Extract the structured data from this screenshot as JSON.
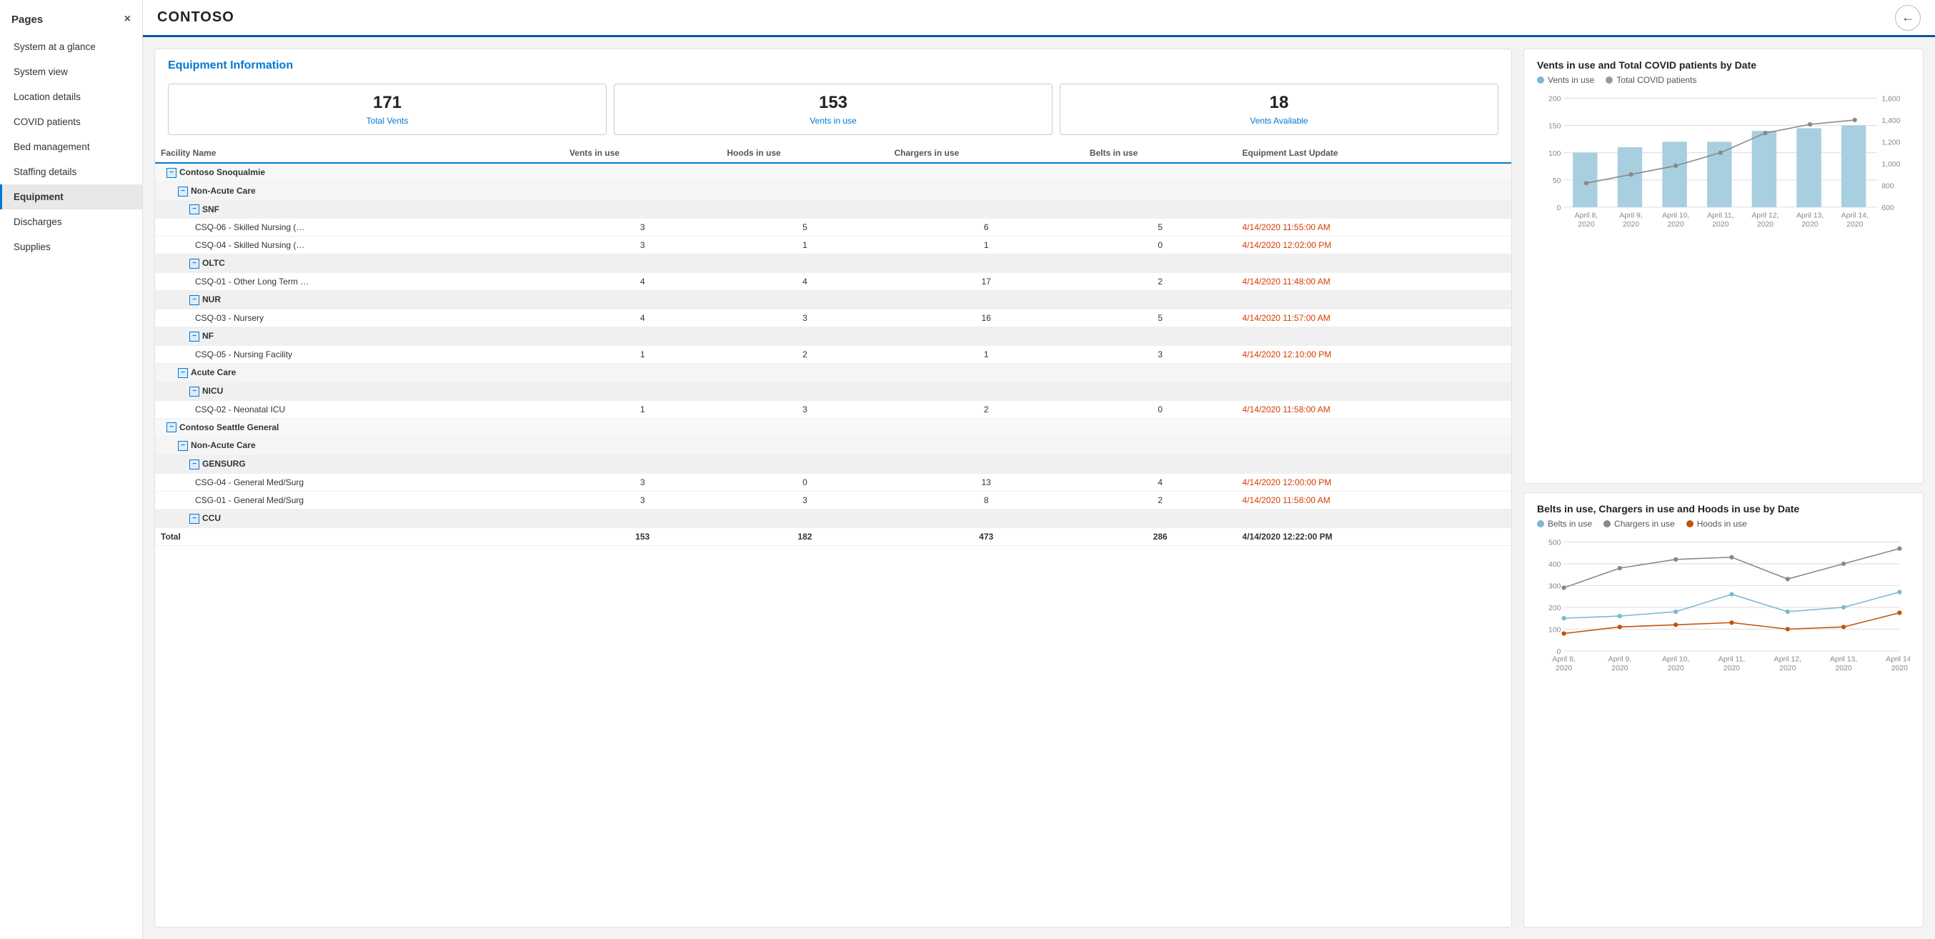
{
  "sidebar": {
    "header": "Pages",
    "close_label": "×",
    "items": [
      {
        "id": "system-at-glance",
        "label": "System at a glance",
        "active": false
      },
      {
        "id": "system-view",
        "label": "System view",
        "active": false
      },
      {
        "id": "location-details",
        "label": "Location details",
        "active": false
      },
      {
        "id": "covid-patients",
        "label": "COVID patients",
        "active": false
      },
      {
        "id": "bed-management",
        "label": "Bed management",
        "active": false
      },
      {
        "id": "staffing-details",
        "label": "Staffing details",
        "active": false
      },
      {
        "id": "equipment",
        "label": "Equipment",
        "active": true
      },
      {
        "id": "discharges",
        "label": "Discharges",
        "active": false
      },
      {
        "id": "supplies",
        "label": "Supplies",
        "active": false
      }
    ]
  },
  "topbar": {
    "title": "CONTOSO",
    "back_label": "←"
  },
  "equipment": {
    "section_title": "Equipment Information",
    "stats": [
      {
        "number": "171",
        "label": "Total Vents"
      },
      {
        "number": "153",
        "label": "Vents in use"
      },
      {
        "number": "18",
        "label": "Vents Available"
      }
    ],
    "table": {
      "columns": [
        "Facility Name",
        "Vents in use",
        "Hoods in use",
        "Chargers in use",
        "Belts in use",
        "Equipment Last Update"
      ],
      "rows": [
        {
          "type": "group1",
          "name": "Contoso Snoqualmie",
          "indent": 1,
          "expand": true
        },
        {
          "type": "group2",
          "name": "Non-Acute Care",
          "indent": 2,
          "expand": true
        },
        {
          "type": "group3",
          "name": "SNF",
          "indent": 3,
          "expand": true
        },
        {
          "type": "data",
          "name": "CSQ-06 - Skilled Nursing (…",
          "indent": 4,
          "vents": 3,
          "hoods": 5,
          "chargers": 6,
          "belts": 5,
          "date": "4/14/2020 11:55:00 AM"
        },
        {
          "type": "data",
          "name": "CSQ-04 - Skilled Nursing (…",
          "indent": 4,
          "vents": 3,
          "hoods": 1,
          "chargers": 1,
          "belts": 0,
          "date": "4/14/2020 12:02:00 PM"
        },
        {
          "type": "group3",
          "name": "OLTC",
          "indent": 3,
          "expand": true
        },
        {
          "type": "data",
          "name": "CSQ-01 - Other Long Term …",
          "indent": 4,
          "vents": 4,
          "hoods": 4,
          "chargers": 17,
          "belts": 2,
          "date": "4/14/2020 11:48:00 AM"
        },
        {
          "type": "group3",
          "name": "NUR",
          "indent": 3,
          "expand": true
        },
        {
          "type": "data",
          "name": "CSQ-03 - Nursery",
          "indent": 4,
          "vents": 4,
          "hoods": 3,
          "chargers": 16,
          "belts": 5,
          "date": "4/14/2020 11:57:00 AM"
        },
        {
          "type": "group3",
          "name": "NF",
          "indent": 3,
          "expand": true
        },
        {
          "type": "data",
          "name": "CSQ-05 - Nursing Facility",
          "indent": 4,
          "vents": 1,
          "hoods": 2,
          "chargers": 1,
          "belts": 3,
          "date": "4/14/2020 12:10:00 PM"
        },
        {
          "type": "group2",
          "name": "Acute Care",
          "indent": 2,
          "expand": true
        },
        {
          "type": "group3",
          "name": "NICU",
          "indent": 3,
          "expand": true
        },
        {
          "type": "data",
          "name": "CSQ-02 - Neonatal ICU",
          "indent": 4,
          "vents": 1,
          "hoods": 3,
          "chargers": 2,
          "belts": 0,
          "date": "4/14/2020 11:58:00 AM"
        },
        {
          "type": "group1",
          "name": "Contoso Seattle General",
          "indent": 1,
          "expand": true
        },
        {
          "type": "group2",
          "name": "Non-Acute Care",
          "indent": 2,
          "expand": true
        },
        {
          "type": "group3",
          "name": "GENSURG",
          "indent": 3,
          "expand": true
        },
        {
          "type": "data",
          "name": "CSG-04 - General Med/Surg",
          "indent": 4,
          "vents": 3,
          "hoods": 0,
          "chargers": 13,
          "belts": 4,
          "date": "4/14/2020 12:00:00 PM"
        },
        {
          "type": "data",
          "name": "CSG-01 - General Med/Surg",
          "indent": 4,
          "vents": 3,
          "hoods": 3,
          "chargers": 8,
          "belts": 2,
          "date": "4/14/2020 11:58:00 AM"
        },
        {
          "type": "group3",
          "name": "CCU",
          "indent": 3,
          "expand": true
        }
      ],
      "total_row": {
        "label": "Total",
        "vents": "153",
        "hoods": "182",
        "chargers": "473",
        "belts": "286",
        "date": "4/14/2020 12:22:00 PM"
      }
    }
  },
  "chart1": {
    "title": "Vents in use and Total COVID patients by Date",
    "legend": [
      {
        "label": "Vents in use",
        "color": "#7ab8d4"
      },
      {
        "label": "Total COVID patients",
        "color": "#999"
      }
    ],
    "y_left_max": 200,
    "y_right_max": 1600,
    "y_right_min": 600,
    "dates": [
      "April 8,\n2020",
      "April 9,\n2020",
      "April 10,\n2020",
      "April 11,\n2020",
      "April 12,\n2020",
      "April 13,\n2020",
      "April 14,\n2020"
    ],
    "bars": [
      100,
      110,
      120,
      120,
      140,
      145,
      150
    ],
    "line": [
      820,
      900,
      980,
      1100,
      1280,
      1360,
      1400
    ]
  },
  "chart2": {
    "title": "Belts in use, Chargers in use and Hoods in use by Date",
    "legend": [
      {
        "label": "Belts in use",
        "color": "#7ab8d4"
      },
      {
        "label": "Chargers in use",
        "color": "#888"
      },
      {
        "label": "Hoods in use",
        "color": "#c0530a"
      }
    ],
    "dates": [
      "April 8,\n2020",
      "April 9,\n2020",
      "April 10,\n2020",
      "April 11,\n2020",
      "April 12,\n2020",
      "April 13,\n2020",
      "April 14,\n2020"
    ],
    "belts": [
      150,
      160,
      180,
      260,
      180,
      200,
      270
    ],
    "chargers": [
      290,
      380,
      420,
      430,
      330,
      400,
      470
    ],
    "hoods": [
      80,
      110,
      120,
      130,
      100,
      110,
      175
    ]
  }
}
